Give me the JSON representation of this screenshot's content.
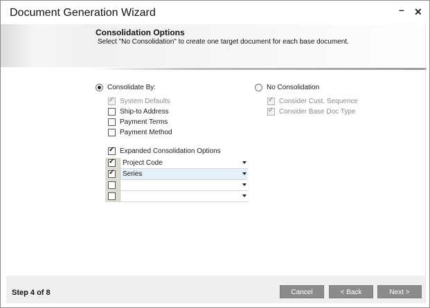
{
  "window": {
    "title": "Document Generation Wizard"
  },
  "header": {
    "title": "Consolidation Options",
    "subtitle": "Select \"No Consolidation\" to create one target document for each base document."
  },
  "consolidate_by": {
    "label": "Consolidate By:",
    "selected": true,
    "options": [
      {
        "label": "System Defaults",
        "checked": true,
        "disabled": true
      },
      {
        "label": "Ship-to Address",
        "checked": false,
        "disabled": false
      },
      {
        "label": "Payment Terms",
        "checked": false,
        "disabled": false
      },
      {
        "label": "Payment Method",
        "checked": false,
        "disabled": false
      }
    ]
  },
  "no_consolidation": {
    "label": "No Consolidation",
    "selected": false,
    "options": [
      {
        "label": "Consider Cust. Sequence",
        "checked": true,
        "disabled": true
      },
      {
        "label": "Consider Base Doc Type",
        "checked": true,
        "disabled": true
      }
    ]
  },
  "expanded": {
    "label": "Expanded Consolidation Options",
    "checked": true,
    "rows": [
      {
        "checked": true,
        "value": "Project Code"
      },
      {
        "checked": true,
        "value": "Series"
      },
      {
        "checked": false,
        "value": ""
      },
      {
        "checked": false,
        "value": ""
      }
    ]
  },
  "footer": {
    "step": "Step 4 of 8",
    "cancel": "Cancel",
    "back": "< Back",
    "next": "Next >"
  }
}
